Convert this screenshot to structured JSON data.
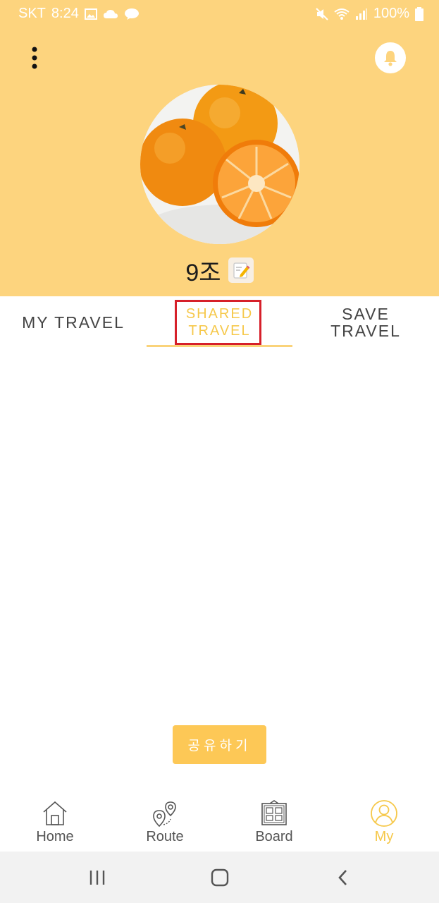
{
  "status_bar": {
    "carrier": "SKT",
    "time": "8:24",
    "battery": "100%"
  },
  "profile": {
    "name": "9조"
  },
  "tabs": [
    {
      "label_line1": "MY TRAVEL",
      "label_line2": ""
    },
    {
      "label_line1": "SHARED",
      "label_line2": "TRAVEL",
      "selected": true
    },
    {
      "label_line1": "SAVE",
      "label_line2": "TRAVEL"
    }
  ],
  "share_button": {
    "label": "공유하기"
  },
  "bottom_nav": [
    {
      "label": "Home",
      "icon": "home-icon"
    },
    {
      "label": "Route",
      "icon": "route-icon"
    },
    {
      "label": "Board",
      "icon": "board-icon"
    },
    {
      "label": "My",
      "icon": "user-icon",
      "active": true
    }
  ],
  "colors": {
    "header": "#fdd47e",
    "accent": "#f6c84a",
    "button": "#fdc856",
    "highlight_box": "#d6202a"
  }
}
